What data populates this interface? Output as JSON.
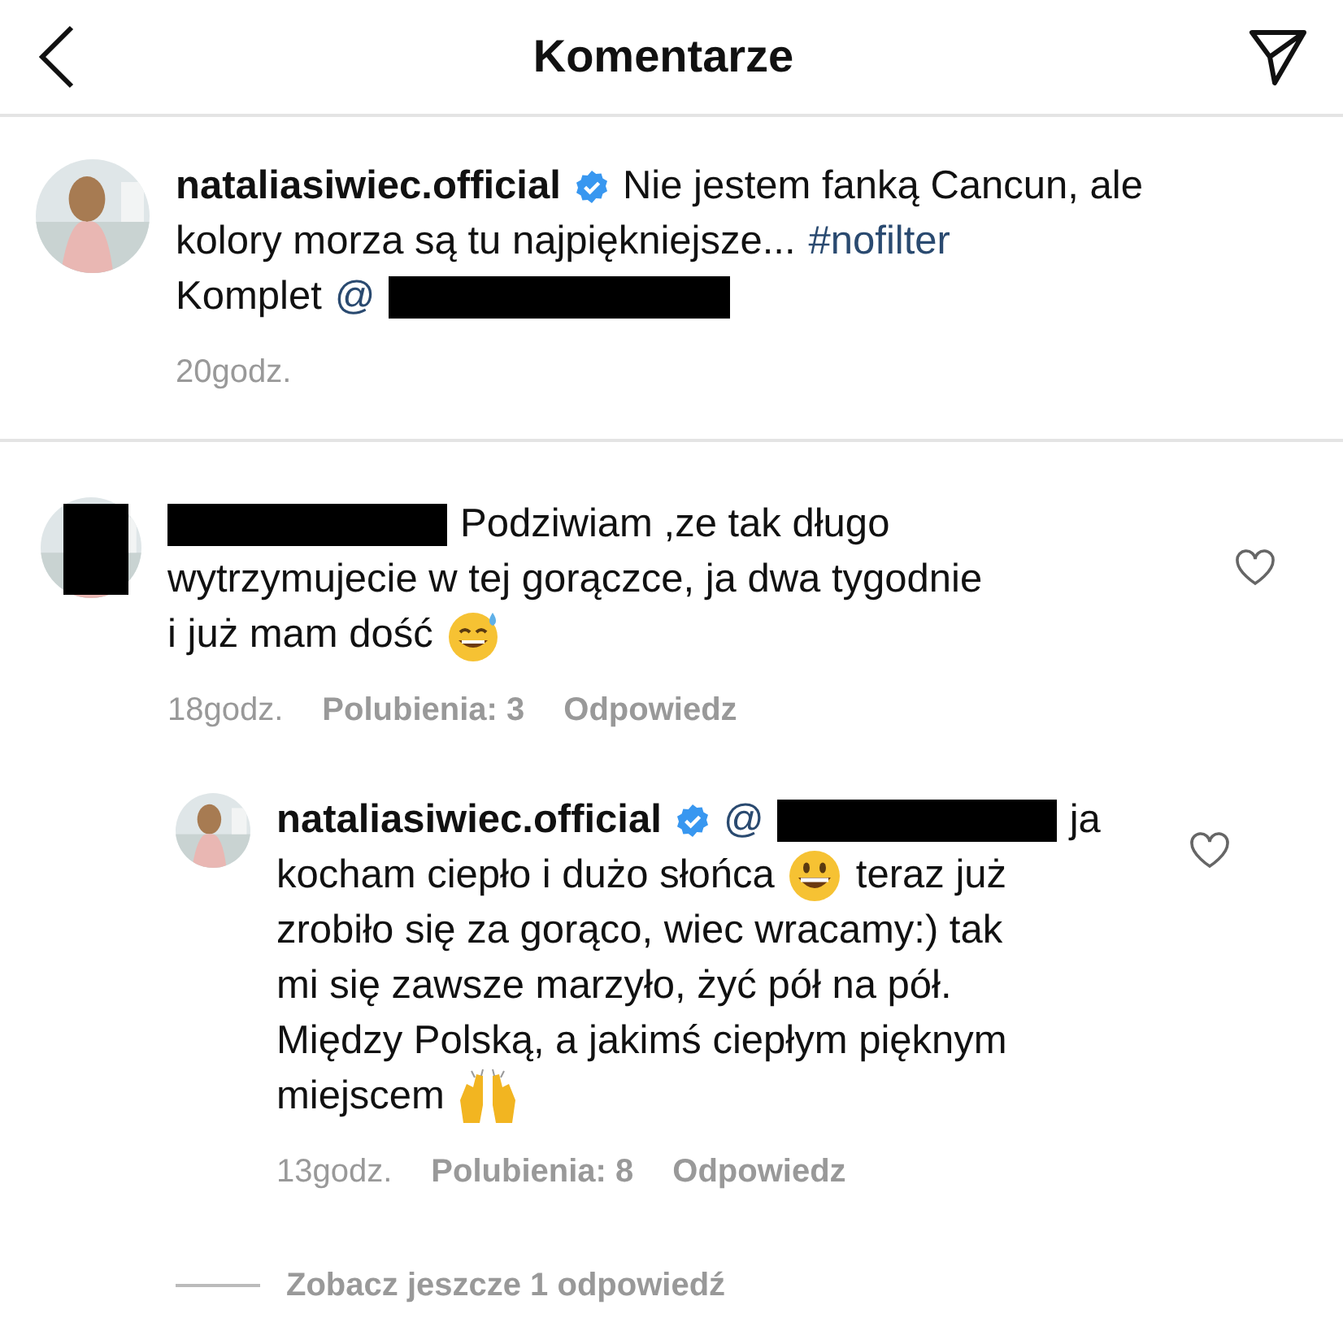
{
  "header": {
    "title": "Komentarze"
  },
  "caption": {
    "username": "nataliasiwiec.official",
    "verified": true,
    "lines": [
      [
        {
          "kind": "text",
          "text": "Nie jestem fanką Cancun, ale"
        }
      ],
      [
        {
          "kind": "text",
          "text": "kolory morza są tu najpiękniejsze..."
        },
        {
          "kind": "link",
          "text": "#nofilter"
        }
      ],
      [
        {
          "kind": "text",
          "text": "Komplet"
        },
        {
          "kind": "link",
          "text": "@"
        },
        {
          "kind": "redaction"
        }
      ]
    ],
    "time": "20godz."
  },
  "comments": [
    {
      "avatar_redacted": true,
      "liked": false,
      "lines": [
        [
          {
            "kind": "redaction"
          },
          {
            "kind": "text",
            "text": "Podziwiam ,ze tak długo"
          }
        ],
        [
          {
            "kind": "text",
            "text": "wytrzymujecie w tej gorączce, ja dwa tygodnie"
          }
        ],
        [
          {
            "kind": "text",
            "text": "i już mam dość"
          },
          {
            "kind": "sweat-smile"
          }
        ]
      ],
      "time": "18godz.",
      "likes": "Polubienia: 3",
      "reply": "Odpowiedz",
      "replies": [
        {
          "username": "nataliasiwiec.official",
          "verified": true,
          "liked": false,
          "lines": [
            [
              {
                "kind": "link",
                "text": "@"
              },
              {
                "kind": "redaction"
              },
              {
                "kind": "text",
                "text": "ja"
              }
            ],
            [
              {
                "kind": "text",
                "text": "kocham ciepło i dużo słońca"
              },
              {
                "kind": "grin"
              },
              {
                "kind": "text",
                "text": "teraz już"
              }
            ],
            [
              {
                "kind": "text",
                "text": "zrobiło się za gorąco, wiec wracamy:) tak"
              }
            ],
            [
              {
                "kind": "text",
                "text": "mi się zawsze marzyło, żyć pół na pół."
              }
            ],
            [
              {
                "kind": "text",
                "text": "Między Polską, a jakimś ciepłym pięknym"
              }
            ],
            [
              {
                "kind": "text",
                "text": "miejscem"
              },
              {
                "kind": "raised-hands"
              }
            ]
          ],
          "time": "13godz.",
          "likes": "Polubienia: 8",
          "reply": "Odpowiedz"
        }
      ]
    }
  ],
  "view_more": "Zobacz jeszcze 1 odpowiedź"
}
